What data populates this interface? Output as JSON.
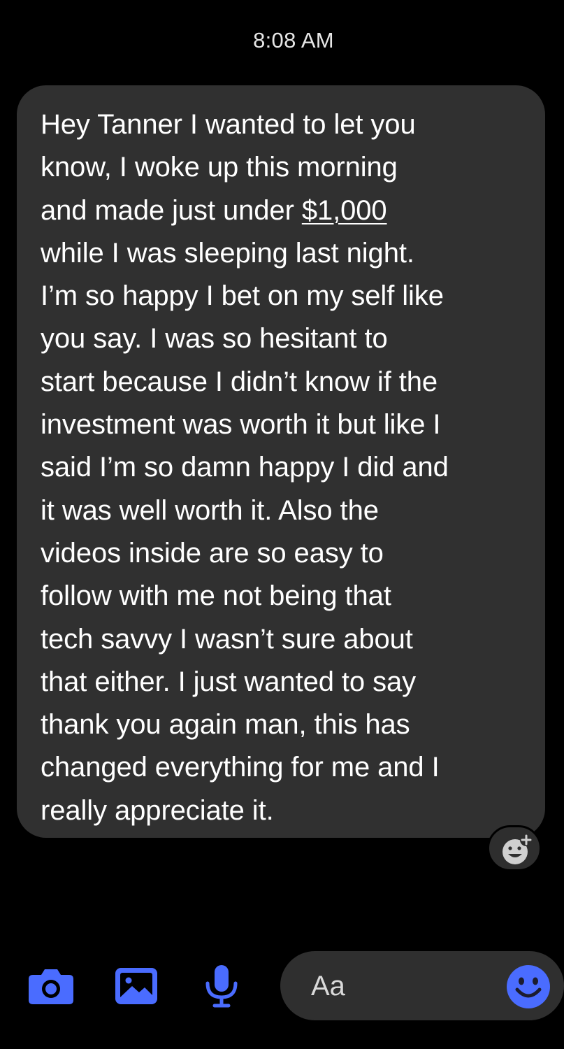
{
  "header": {
    "timestamp": "8:08 AM"
  },
  "message": {
    "lines": [
      "Hey Tanner I wanted to let you",
      "know, I woke up this morning",
      "and made just under ",
      "while I was sleeping last night.",
      "I’m so happy I bet on my self like",
      "you say. I was so hesitant to",
      "start because I didn’t know if the",
      "investment was worth it but like I",
      "said I’m so damn happy I did and",
      "it was well worth it. Also the",
      "videos inside are so easy to",
      "follow with me not being that",
      "tech savvy I wasn’t sure about",
      "that either. I just wanted to say",
      "thank you again man, this has",
      "changed everything for me and I",
      "really appreciate it."
    ],
    "amount_link": "$1,000"
  },
  "composer": {
    "placeholder": "Aa",
    "icons": [
      "camera-icon",
      "photo-gallery-icon",
      "microphone-icon",
      "smiley-emoji-icon"
    ],
    "accent_color": "#4a6cff"
  },
  "reaction": {
    "icon": "add-reaction-icon"
  },
  "colors": {
    "background": "#000000",
    "bubble": "#303030",
    "text": "#ffffff",
    "accent": "#4a6cff"
  }
}
